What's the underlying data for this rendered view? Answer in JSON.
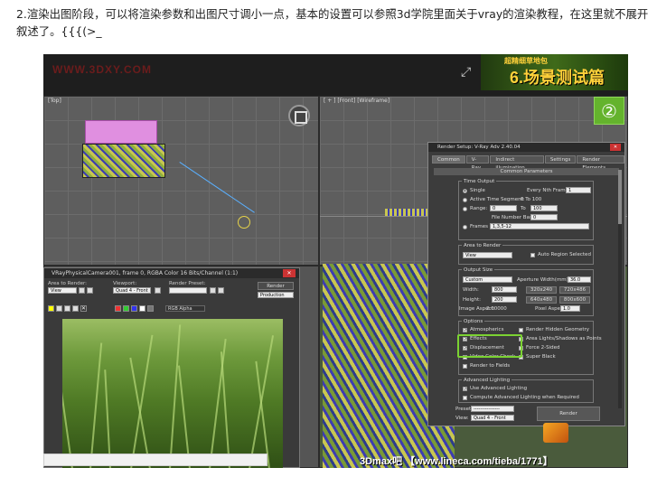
{
  "caption": "2.渲染出图阶段，可以将渲染参数和出图尺寸调小一点，基本的设置可以参照3d学院里面关于vray的渲染教程，在这里就不展开叙述了。{{{(>_",
  "header": {
    "watermark": "WWW.3DXY.COM",
    "title_small": "超精细草地包",
    "title_big": "6.场景测试篇",
    "step_badge": "②"
  },
  "viewports": {
    "top_left_label": "[Top]",
    "top_right_label": "[ + ] [Front] [Wireframe]"
  },
  "frame_buffer": {
    "title": "VRayPhysicalCamera001, frame 0, RGBA Color 16 Bits/Channel (1:1)",
    "area_label": "Area to Render:",
    "area_value": "View",
    "viewport_label": "Viewport:",
    "viewport_value": "Quad 4 - Front",
    "preset_label": "Render Preset:",
    "render_label": "Render",
    "production_value": "Production",
    "channel_value": "RGB Alpha"
  },
  "render_setup": {
    "title": "Render Setup: V-Ray Adv 2.40.04",
    "tabs": [
      "Common",
      "V-Ray",
      "Indirect illumination",
      "Settings",
      "Render Elements"
    ],
    "panel_title": "Common Parameters",
    "time_output": {
      "title": "Time Output",
      "single": "Single",
      "every_nth": "Every Nth Frame:",
      "every_nth_value": "1",
      "active_segment": "Active Time Segment:",
      "active_segment_value": "0 To 100",
      "range": "Range:",
      "range_from": "0",
      "range_to_label": "To",
      "range_to": "100",
      "file_number_base": "File Number Base:",
      "file_number_value": "0",
      "frames": "Frames",
      "frames_value": "1,3,5-12"
    },
    "area": {
      "title": "Area to Render",
      "value": "View",
      "auto_region": "Auto Region Selected"
    },
    "output_size": {
      "title": "Output Size",
      "preset": "Custom",
      "aperture_label": "Aperture Width(mm):",
      "aperture_value": "36.0",
      "width_label": "Width:",
      "width_value": "800",
      "height_label": "Height:",
      "height_value": "200",
      "presets": [
        "320x240",
        "720x486",
        "640x480",
        "800x600"
      ],
      "image_aspect_label": "Image Aspect:",
      "image_aspect_value": "2.00000",
      "pixel_aspect_label": "Pixel Aspect:",
      "pixel_aspect_value": "1.0"
    },
    "options": {
      "title": "Options",
      "atmospherics": "Atmospherics",
      "effects": "Effects",
      "displacement": "Displacement",
      "video_color": "Video Color Check",
      "render_fields": "Render to Fields",
      "hidden_geo": "Render Hidden Geometry",
      "area_lights": "Area Lights/Shadows as Points",
      "force_2sided": "Force 2-Sided",
      "super_black": "Super Black"
    },
    "advanced_lighting": {
      "title": "Advanced Lighting",
      "use": "Use Advanced Lighting",
      "compute": "Compute Advanced Lighting when Required"
    },
    "preset_label": "Preset:",
    "preset_value": "----------------",
    "view_label": "View:",
    "view_value": "Quad 4 - Front",
    "render_button": "Render"
  },
  "footer_watermark": "3Dmax吧 【www.lineca.com/tieba/1771】",
  "colors": {
    "accent_green": "#7bd232",
    "badge_green": "#64b32d",
    "title_yellow": "#ffd13a"
  }
}
